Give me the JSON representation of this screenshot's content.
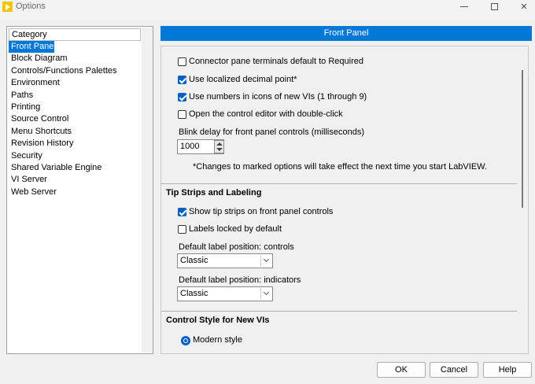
{
  "window": {
    "title": "Options"
  },
  "sidebar": {
    "header": "Category",
    "items": [
      {
        "label": "Front Panel",
        "selected": true
      },
      {
        "label": "Block Diagram"
      },
      {
        "label": "Controls/Functions Palettes"
      },
      {
        "label": "Environment"
      },
      {
        "label": "Paths"
      },
      {
        "label": "Printing"
      },
      {
        "label": "Source Control"
      },
      {
        "label": "Menu Shortcuts"
      },
      {
        "label": "Revision History"
      },
      {
        "label": "Security"
      },
      {
        "label": "Shared Variable Engine"
      },
      {
        "label": "VI Server"
      },
      {
        "label": "Web Server"
      }
    ]
  },
  "panel": {
    "header": "Front Panel",
    "options": [
      {
        "label": "Connector pane terminals default to Required",
        "checked": false
      },
      {
        "label": "Use localized decimal point*",
        "checked": true
      },
      {
        "label": "Use numbers in icons of new VIs (1 through 9)",
        "checked": true
      },
      {
        "label": "Open the control editor with double-click",
        "checked": false
      }
    ],
    "blink": {
      "label": "Blink delay for front panel controls (milliseconds)",
      "value": "1000"
    },
    "note": "*Changes to marked options will take effect the next time you start LabVIEW.",
    "tip_section": {
      "title": "Tip Strips and Labeling",
      "options": [
        {
          "label": "Show tip strips on front panel controls",
          "checked": true
        },
        {
          "label": "Labels locked by default",
          "checked": false
        }
      ],
      "controls_label": "Default label position: controls",
      "controls_value": "Classic",
      "indicators_label": "Default label position: indicators",
      "indicators_value": "Classic"
    },
    "style_section": {
      "title": "Control Style for New VIs",
      "radio_label": "Modern style",
      "selected": true
    }
  },
  "buttons": {
    "ok": "OK",
    "cancel": "Cancel",
    "help": "Help"
  },
  "colors": {
    "accent": "#0078d7"
  }
}
